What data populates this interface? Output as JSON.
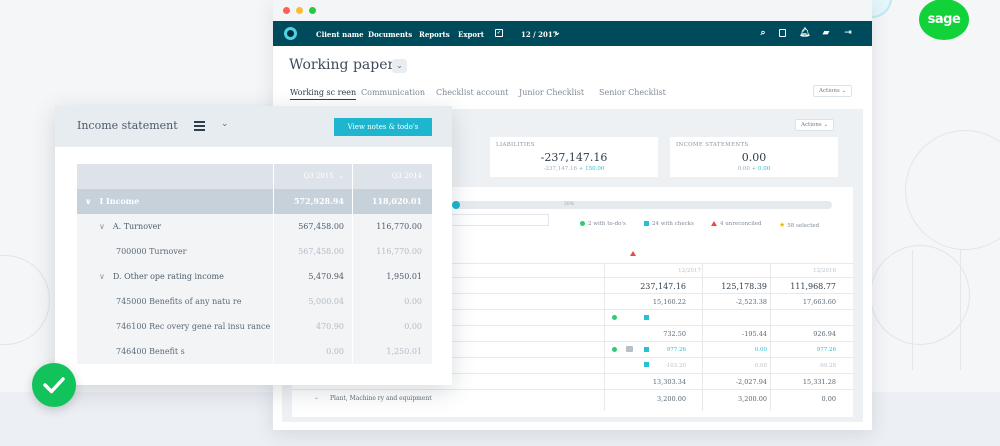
{
  "brand": {
    "name": "sage",
    "color": "#12d23a"
  },
  "nav": {
    "links": [
      "Client name",
      "Documents",
      "Reports",
      "Export"
    ],
    "period": "12 / 2017",
    "icons": [
      "calendar-icon",
      "search-icon",
      "tablet-icon",
      "bell-icon",
      "chat-icon",
      "logout-icon"
    ]
  },
  "working_papers": {
    "title": "Working papers",
    "tabs": [
      "Working sc reen",
      "Communication",
      "Checklist account",
      "Junior Checklist",
      "Senior Checklist"
    ],
    "actions_label": "Actions"
  },
  "summary": {
    "actions_label": "Actions",
    "cards": [
      {
        "title": "LIABILITIES",
        "value": "-237,147.16",
        "sub": "-237,147.16 +",
        "sub_accent": "150.00"
      },
      {
        "title": "INCOME STATEMENTS",
        "value": "0.00",
        "sub": "0.00 +",
        "sub_accent": "0.00"
      }
    ]
  },
  "progress": {
    "label": "20%",
    "fraction": 0.02
  },
  "legend": [
    {
      "label": "2 with to-do's",
      "color": "#2ecc71",
      "shape": "dot"
    },
    {
      "label": "24 with checks",
      "color": "#26c0d3",
      "shape": "square"
    },
    {
      "label": "4 unreconciled",
      "color": "#e74c3c",
      "shape": "triangle"
    },
    {
      "label": "58 selected",
      "color": "#f5b800",
      "shape": "star"
    }
  ],
  "grid": {
    "col_headers": [
      "12/2017",
      "12/2016"
    ],
    "totals": [
      "237,147.16",
      "125,178.39",
      "111,968.77"
    ],
    "rows": [
      [
        "15,160.22",
        "-2,523.38",
        "17,663.60"
      ],
      [
        "732.50",
        "-195.44",
        "926.94"
      ],
      [
        "977.26",
        "0.00",
        "977.26"
      ],
      [
        "-103.20",
        "0.00",
        "-99.28"
      ],
      [
        "13,303.34",
        "-2,027.94",
        "15,331.28"
      ],
      [
        "3,200.00",
        "3,200.00",
        "0.00"
      ]
    ],
    "last_label": "Plant, Machine ry and equipment"
  },
  "income": {
    "title": "Income statement",
    "view_button": "View notes & todo's",
    "col1": "Q3 2015",
    "col2": "Q3 2014",
    "rows": [
      {
        "label": "I Income",
        "v1": "572,928.94",
        "v2": "118,020.01",
        "kind": "main",
        "prefix": "∨"
      },
      {
        "label": "A. Turnover",
        "v1": "567,458.00",
        "v2": "116,770.00",
        "kind": "sub",
        "prefix": "∨"
      },
      {
        "label": "700000  Turnover",
        "v1": "567,458.00",
        "v2": "116,770.00",
        "kind": "faint",
        "prefix": ""
      },
      {
        "label": "D. Other ope rating income",
        "v1": "5,470.94",
        "v2": "1,950.01",
        "kind": "sub",
        "prefix": "∨"
      },
      {
        "label": "745000 Benefits of any natu    re",
        "v1": "5,000.04",
        "v2": "0.00",
        "kind": "faint",
        "prefix": ""
      },
      {
        "label": "746100 Rec  overy gene ral insu rance",
        "v1": "470.90",
        "v2": "0.00",
        "kind": "faint",
        "prefix": ""
      },
      {
        "label": "746400 Benefit   s",
        "v1": "0.00",
        "v2": "1,250.01",
        "kind": "faint",
        "prefix": ""
      }
    ]
  }
}
